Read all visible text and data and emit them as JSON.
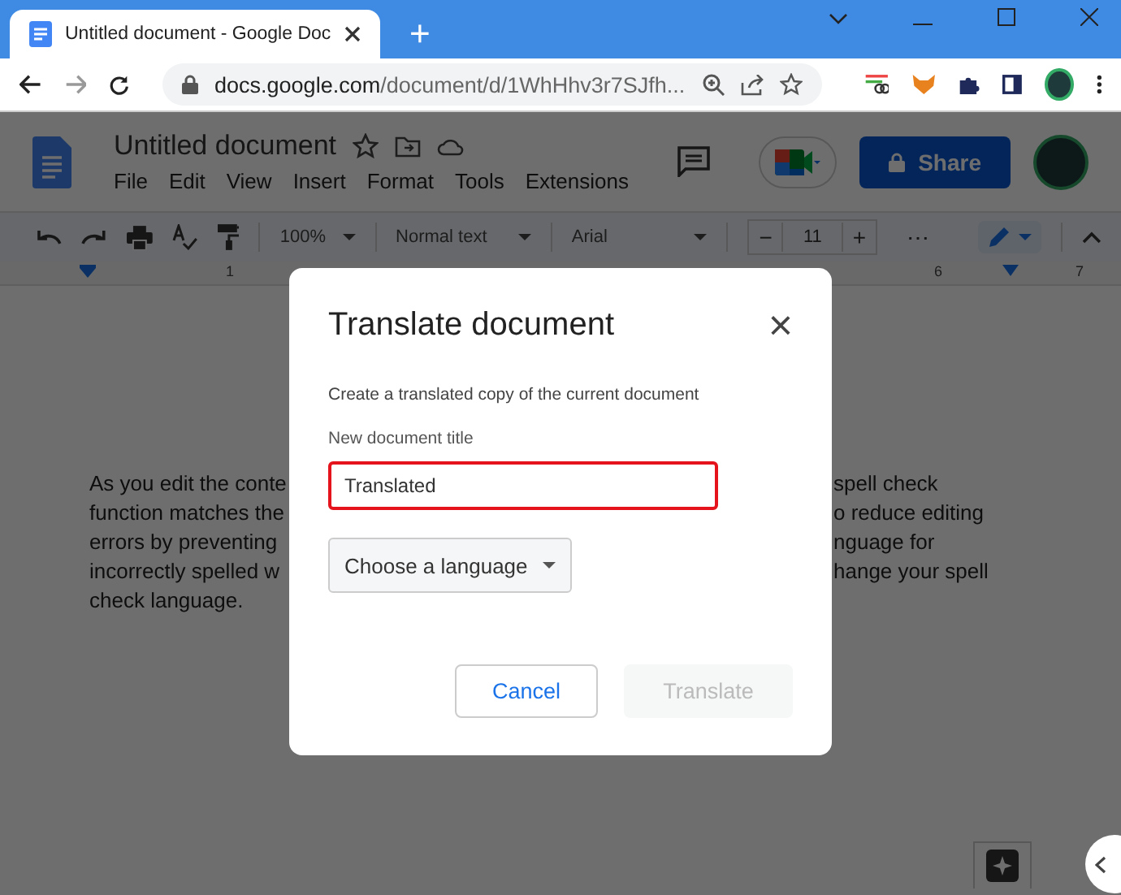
{
  "browser": {
    "tab_title": "Untitled document - Google Doc",
    "new_tab": "+",
    "url_host": "docs.google.com",
    "url_path": "/document/d/1WhHhv3r7SJfh..."
  },
  "docs": {
    "title": "Untitled document",
    "share": "Share",
    "menu": [
      {
        "label": "File"
      },
      {
        "label": "Edit"
      },
      {
        "label": "View"
      },
      {
        "label": "Insert"
      },
      {
        "label": "Format"
      },
      {
        "label": "Tools"
      },
      {
        "label": "Extensions"
      }
    ],
    "toolbar": {
      "zoom": "100%",
      "style": "Normal text",
      "font": "Arial",
      "font_size": "11",
      "minus": "−",
      "plus": "+",
      "more": "⋯"
    },
    "ruler": [
      "1",
      "6",
      "7"
    ],
    "body_lines": [
      {
        "left": "As you edit the conte",
        "right": "spell check"
      },
      {
        "left": "function matches the",
        "right": "o reduce editing"
      },
      {
        "left": "errors by preventing",
        "right": "nguage for"
      },
      {
        "left": "incorrectly spelled w",
        "right": "hange your spell"
      },
      {
        "left": "check language."
      }
    ]
  },
  "dialog": {
    "title": "Translate document",
    "close": "×",
    "description": "Create a translated copy of the current document",
    "field_label": "New document title",
    "field": {
      "value": "Translated",
      "highlighted": true
    },
    "language": "Choose a language",
    "buttons": [
      {
        "label": "Cancel",
        "disabled": false
      },
      {
        "label": "Translate",
        "disabled": true
      }
    ]
  }
}
